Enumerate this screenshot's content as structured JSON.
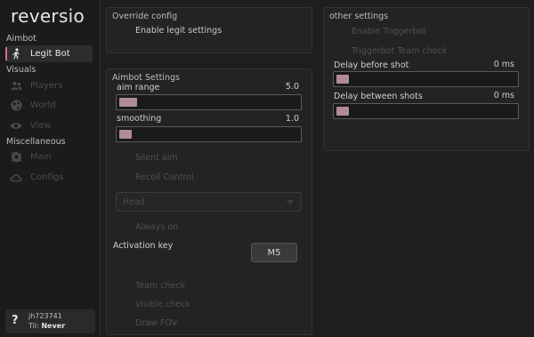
{
  "app": {
    "logo": "reversio"
  },
  "sidebar": {
    "sections": {
      "aimbot": "Aimbot",
      "visuals": "Visuals",
      "misc": "Miscellaneous"
    },
    "items": [
      {
        "label": "Legit Bot",
        "icon": "running-person-icon",
        "active": true
      },
      {
        "label": "Players",
        "icon": "users-icon",
        "active": false
      },
      {
        "label": "World",
        "icon": "globe-icon",
        "active": false
      },
      {
        "label": "View",
        "icon": "eye-icon",
        "active": false
      },
      {
        "label": "Main",
        "icon": "gear-icon",
        "active": false
      },
      {
        "label": "Configs",
        "icon": "cloud-icon",
        "active": false
      }
    ]
  },
  "user": {
    "badge": "?",
    "name": "jh723741",
    "til_label": "Til:",
    "til_value": "Never"
  },
  "override": {
    "title": "Override config",
    "enable_legit": "Enable legit settings"
  },
  "aimbot": {
    "title": "Aimbot Settings",
    "aim_range": {
      "label": "aim range",
      "value": "5.0",
      "fill": 0.1
    },
    "smoothing": {
      "label": "smoothing",
      "value": "1.0",
      "fill": 0.05
    },
    "silent_aim": "Silent aim",
    "recoil_control": "Recoil Control",
    "hitbox": "Head",
    "always_on": "Always on",
    "activation_key_label": "Activation key",
    "activation_key_value": "M5",
    "team_check": "Team check",
    "visible_check": "Visible check",
    "draw_fov": "Draw FOV"
  },
  "other": {
    "title": "other settings",
    "enable_triggerbot": "Enable Triggerbot",
    "triggerbot_team_check": "Triggerbot Team check",
    "delay_before": {
      "label": "Delay before shot",
      "value": "0 ms",
      "fill": 0.0
    },
    "delay_between": {
      "label": "Delay between shots",
      "value": "0 ms",
      "fill": 0.0
    }
  },
  "colors": {
    "accent": "#d56a8a",
    "slider_fill": "#b08a9a",
    "background": "#1e1e1e"
  }
}
